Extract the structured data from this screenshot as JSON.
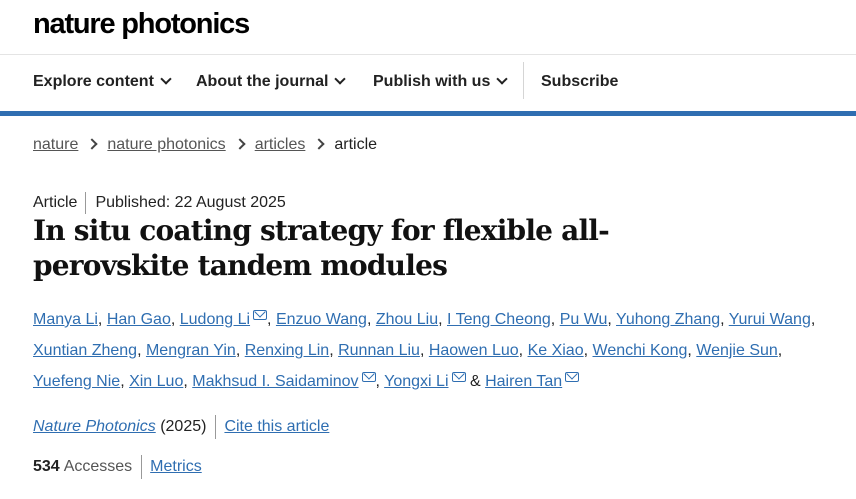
{
  "brand": {
    "logo_text": "nature photonics"
  },
  "nav": {
    "items": [
      {
        "label": "Explore content"
      },
      {
        "label": "About the journal"
      },
      {
        "label": "Publish with us"
      }
    ],
    "subscribe": "Subscribe"
  },
  "breadcrumb": [
    "nature",
    "nature photonics",
    "articles",
    "article"
  ],
  "article": {
    "type": "Article",
    "published": "Published: 22 August 2025",
    "title": "In situ coating strategy for flexible all-perovskite tandem modules",
    "authors": [
      "Manya Li",
      "Han Gao",
      "Ludong Li",
      "Enzuo Wang",
      "Zhou Liu",
      "I Teng Cheong",
      "Pu Wu",
      "Yuhong Zhang",
      "Yurui Wang",
      "Xuntian Zheng",
      "Mengran Yin",
      "Renxing Lin",
      "Runnan Liu",
      "Haowen Luo",
      "Ke Xiao",
      "Wenchi Kong",
      "Wenjie Sun",
      "Yuefeng Nie",
      "Xin Luo",
      "Makhsud I. Saidaminov",
      "Yongxi Li",
      "Hairen Tan"
    ],
    "ampersand": "&",
    "journal": "Nature Photonics",
    "year": "(2025)",
    "cite": "Cite this article"
  },
  "metrics": {
    "accesses_count": "534",
    "accesses_label": "Accesses",
    "metrics_link": "Metrics"
  },
  "colors": {
    "accent": "#2f6eb1",
    "text": "#222222"
  }
}
